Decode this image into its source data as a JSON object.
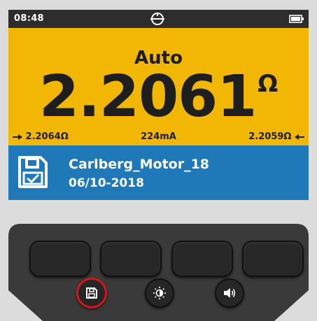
{
  "status_bar": {
    "time": "08:48",
    "logo_icon": "brand-logo-icon",
    "battery_icon": "battery-icon"
  },
  "reading": {
    "mode": "Auto",
    "value": "2.2061",
    "unit": "Ω",
    "min_value": "2.2064Ω",
    "current": "224mA",
    "max_value": "2.2059Ω"
  },
  "saved_record": {
    "icon": "save-check-icon",
    "name": "Carlberg_Motor_18",
    "date": "06/10-2018"
  },
  "keypad": {
    "soft_keys": 4,
    "round_keys": [
      "save-icon",
      "brightness-icon",
      "volume-icon"
    ],
    "selected_key": "save"
  },
  "colors": {
    "status_bar": "#2d2d2d",
    "reading_panel": "#f2b705",
    "save_panel": "#1f79b9",
    "selected_ring": "#d9141b"
  }
}
